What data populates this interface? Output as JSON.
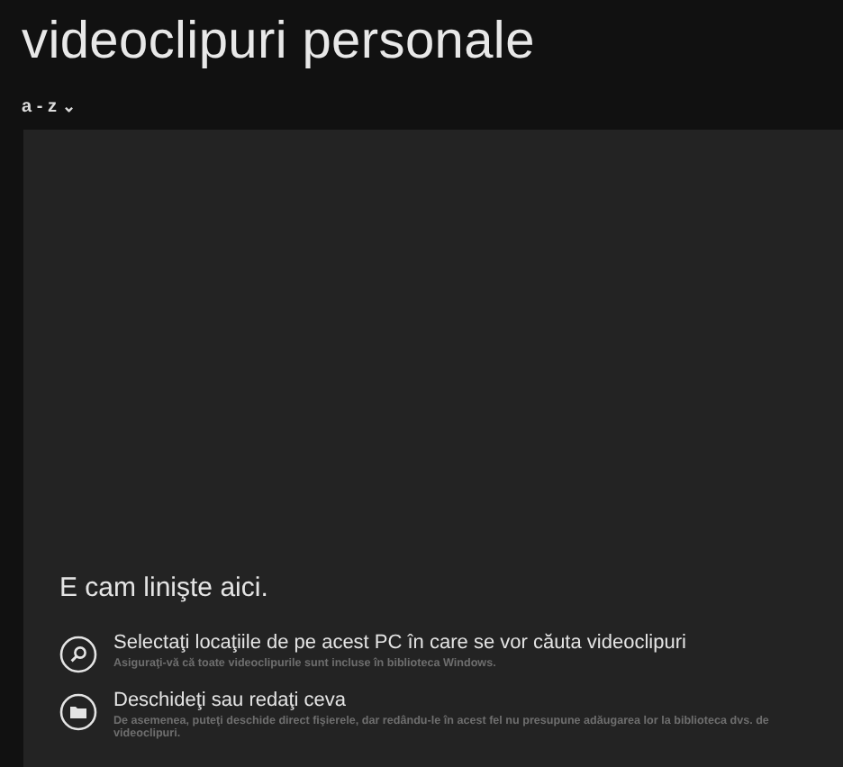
{
  "header": {
    "title": "videoclipuri personale"
  },
  "sort": {
    "label": "a - z",
    "caret": "⌄"
  },
  "empty_state": {
    "message": "E cam linişte aici.",
    "actions": [
      {
        "kind": "search",
        "title": "Selectaţi locaţiile de pe acest PC în care se vor căuta videoclipuri",
        "subtitle": "Asiguraţi-vă că toate videoclipurile sunt incluse în biblioteca Windows."
      },
      {
        "kind": "folder",
        "title": "Deschideţi sau redaţi ceva",
        "subtitle": "De asemenea, puteţi deschide direct fişierele, dar redându-le în acest fel nu presupune adăugarea lor la biblioteca dvs. de videoclipuri."
      }
    ]
  }
}
